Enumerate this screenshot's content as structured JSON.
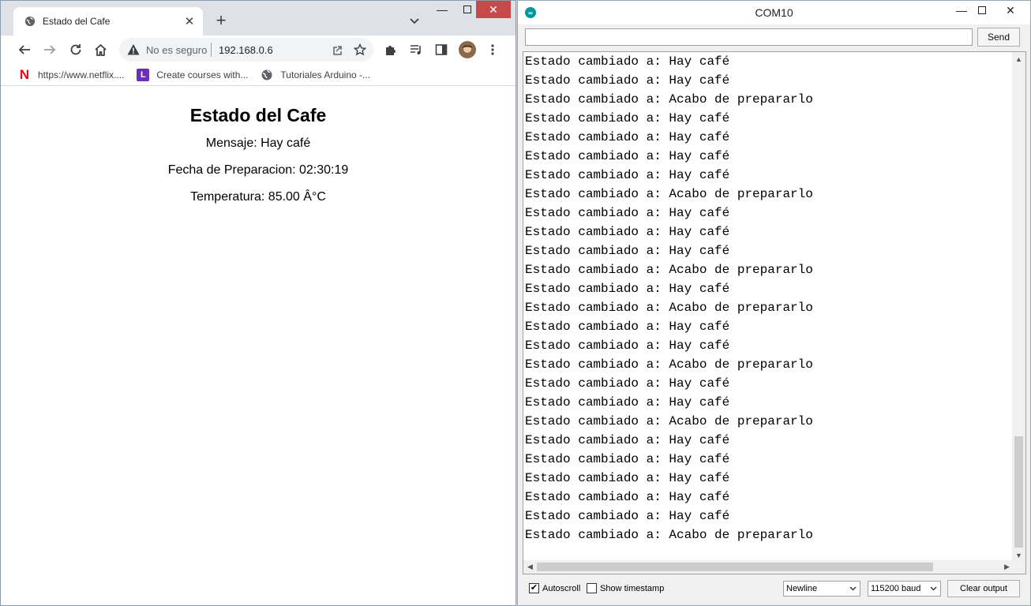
{
  "browser": {
    "tab_title": "Estado del Cafe",
    "address_warning": "No es seguro",
    "url": "192.168.0.6",
    "bookmarks": [
      {
        "label": "https://www.netflix....",
        "icon": "netflix-icon"
      },
      {
        "label": "Create courses with...",
        "icon": "l-letter-icon"
      },
      {
        "label": "Tutoriales Arduino -...",
        "icon": "globe-icon"
      }
    ]
  },
  "page": {
    "heading": "Estado del Cafe",
    "mensaje": "Mensaje: Hay café",
    "fecha": "Fecha de Preparacion: 02:30:19",
    "temperatura": "Temperatura: 85.00 Â°C"
  },
  "serial": {
    "title": "COM10",
    "send_label": "Send",
    "send_value": "",
    "lines": [
      "Estado cambiado a: Hay café",
      "Estado cambiado a: Hay café",
      "Estado cambiado a: Acabo de prepararlo",
      "Estado cambiado a: Hay café",
      "Estado cambiado a: Hay café",
      "Estado cambiado a: Hay café",
      "Estado cambiado a: Hay café",
      "Estado cambiado a: Acabo de prepararlo",
      "Estado cambiado a: Hay café",
      "Estado cambiado a: Hay café",
      "Estado cambiado a: Hay café",
      "Estado cambiado a: Acabo de prepararlo",
      "Estado cambiado a: Hay café",
      "Estado cambiado a: Acabo de prepararlo",
      "Estado cambiado a: Hay café",
      "Estado cambiado a: Hay café",
      "Estado cambiado a: Acabo de prepararlo",
      "Estado cambiado a: Hay café",
      "Estado cambiado a: Hay café",
      "Estado cambiado a: Acabo de prepararlo",
      "Estado cambiado a: Hay café",
      "Estado cambiado a: Hay café",
      "Estado cambiado a: Hay café",
      "Estado cambiado a: Hay café",
      "Estado cambiado a: Hay café",
      "Estado cambiado a: Acabo de prepararlo"
    ],
    "autoscroll_label": "Autoscroll",
    "autoscroll_checked": true,
    "timestamp_label": "Show timestamp",
    "timestamp_checked": false,
    "line_ending": "Newline",
    "baud": "115200 baud",
    "clear_label": "Clear output"
  },
  "colors": {
    "chrome_close": "#c74a4a",
    "arduino_teal": "#00979c"
  }
}
